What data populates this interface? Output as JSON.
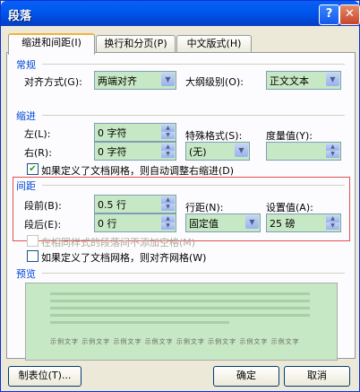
{
  "window": {
    "title": "段落",
    "help_icon": "?",
    "close_icon": "✕"
  },
  "tabs": [
    "缩进和间距(I)",
    "换行和分页(P)",
    "中文版式(H)"
  ],
  "general": {
    "section": "常规",
    "align_label": "对齐方式(G):",
    "align_value": "两端对齐",
    "outline_label": "大纲级别(O):",
    "outline_value": "正文文本"
  },
  "indent": {
    "section": "缩进",
    "left_label": "左(L):",
    "left_value": "0 字符",
    "right_label": "右(R):",
    "right_value": "0 字符",
    "special_label": "特殊格式(S):",
    "special_value": "(无)",
    "measure_label": "度量值(Y):",
    "measure_value": "",
    "grid_check": "如果定义了文档网格，则自动调整右缩进(D)"
  },
  "spacing": {
    "section": "间距",
    "before_label": "段前(B):",
    "before_value": "0.5 行",
    "after_label": "段后(E):",
    "after_value": "0 行",
    "line_label": "行距(N):",
    "line_value": "固定值",
    "setting_label": "设置值(A):",
    "setting_value": "25 磅",
    "no_space_check": "在相同样式的段落间不添加空格(M)",
    "snap_check": "如果定义了文档网格，则对齐网格(W)"
  },
  "preview": {
    "section": "预览",
    "sample_text": "示例文字 示例文字 示例文字 示例文字 示例文字 示例文字 示例文字 示例文字"
  },
  "buttons": {
    "tabs": "制表位(T)...",
    "ok": "确定",
    "cancel": "取消"
  }
}
